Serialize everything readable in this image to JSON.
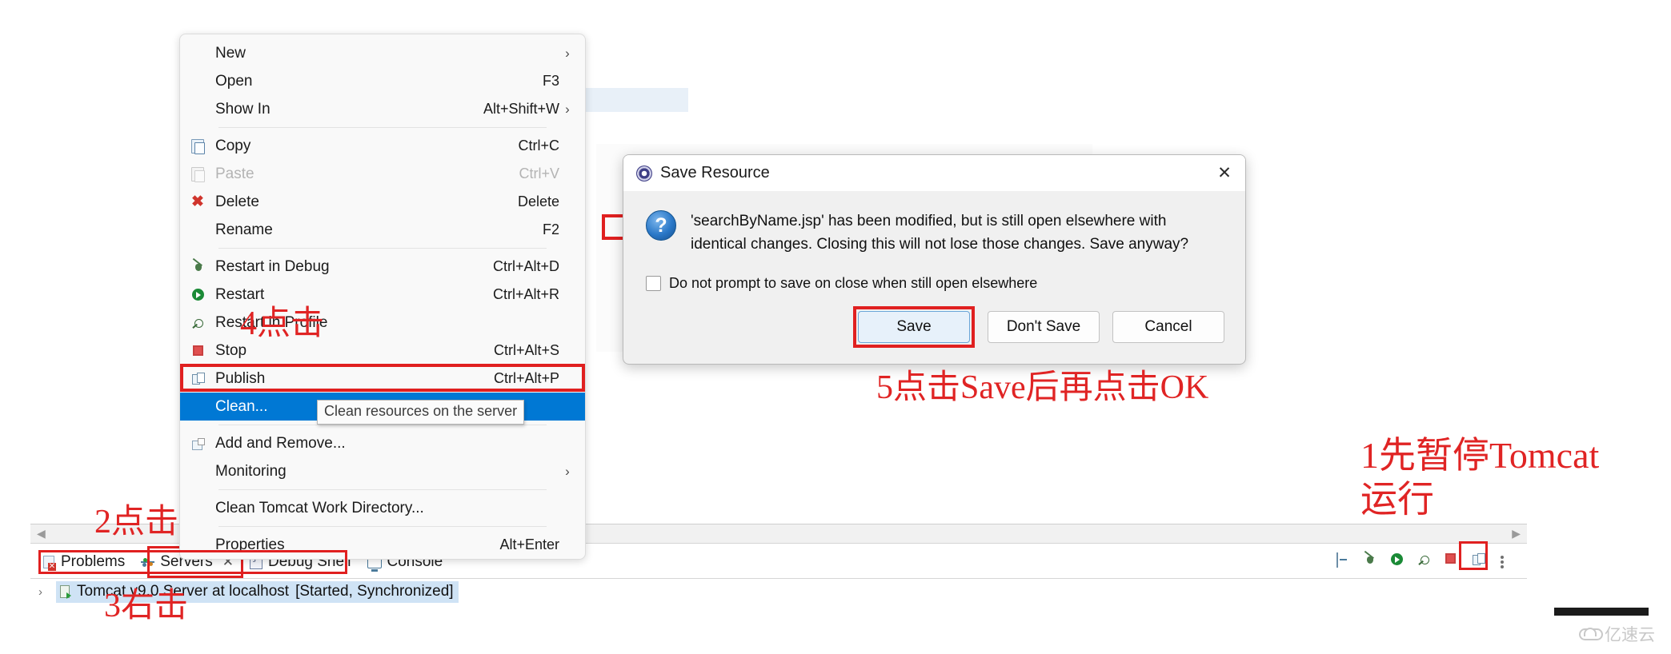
{
  "context_menu": {
    "items": [
      {
        "label": "New",
        "accel": "",
        "icon": "none",
        "submenu": true,
        "disabled": false,
        "selected": false
      },
      {
        "label": "Open",
        "accel": "F3",
        "icon": "none",
        "submenu": false,
        "disabled": false,
        "selected": false
      },
      {
        "label": "Show In",
        "accel": "Alt+Shift+W",
        "icon": "none",
        "submenu": true,
        "disabled": false,
        "selected": false
      },
      {
        "separator": true
      },
      {
        "label": "Copy",
        "accel": "Ctrl+C",
        "icon": "copy-icon",
        "submenu": false,
        "disabled": false,
        "selected": false
      },
      {
        "label": "Paste",
        "accel": "Ctrl+V",
        "icon": "paste-icon",
        "submenu": false,
        "disabled": true,
        "selected": false
      },
      {
        "label": "Delete",
        "accel": "Delete",
        "icon": "delete-icon",
        "submenu": false,
        "disabled": false,
        "selected": false
      },
      {
        "label": "Rename",
        "accel": "F2",
        "icon": "none",
        "submenu": false,
        "disabled": false,
        "selected": false
      },
      {
        "separator": true
      },
      {
        "label": "Restart in Debug",
        "accel": "Ctrl+Alt+D",
        "icon": "bug-icon",
        "submenu": false,
        "disabled": false,
        "selected": false
      },
      {
        "label": "Restart",
        "accel": "Ctrl+Alt+R",
        "icon": "play-icon",
        "submenu": false,
        "disabled": false,
        "selected": false
      },
      {
        "label": "Restart in Profile",
        "accel": "",
        "icon": "profile-icon",
        "submenu": false,
        "disabled": false,
        "selected": false
      },
      {
        "label": "Stop",
        "accel": "Ctrl+Alt+S",
        "icon": "stop-icon",
        "submenu": false,
        "disabled": false,
        "selected": false
      },
      {
        "label": "Publish",
        "accel": "Ctrl+Alt+P",
        "icon": "publish-icon",
        "submenu": false,
        "disabled": false,
        "selected": false
      },
      {
        "label": "Clean...",
        "accel": "",
        "icon": "none",
        "submenu": false,
        "disabled": false,
        "selected": true
      },
      {
        "separator": true
      },
      {
        "label": "Add and Remove...",
        "accel": "",
        "icon": "add-remove-icon",
        "submenu": false,
        "disabled": false,
        "selected": false
      },
      {
        "label": "Monitoring",
        "accel": "",
        "icon": "none",
        "submenu": true,
        "disabled": false,
        "selected": false
      },
      {
        "separator": true
      },
      {
        "label": "Clean Tomcat Work Directory...",
        "accel": "",
        "icon": "none",
        "submenu": false,
        "disabled": false,
        "selected": false
      },
      {
        "separator": true
      },
      {
        "label": "Properties",
        "accel": "Alt+Enter",
        "icon": "none",
        "submenu": false,
        "disabled": false,
        "selected": false
      }
    ],
    "tooltip": "Clean resources on the server",
    "selection_outline_color": "#e02020",
    "selection_bg_color": "#0078d4"
  },
  "dialog": {
    "title": "Save Resource",
    "close_label": "✕",
    "message": "'searchByName.jsp' has been modified, but is still open elsewhere with identical changes. Closing this will not lose those changes. Save anyway?",
    "question_glyph": "?",
    "checkbox_label": "Do not prompt to save on close when still open elsewhere",
    "checkbox_checked": false,
    "buttons": [
      {
        "label": "Save",
        "default": true
      },
      {
        "label": "Don't Save",
        "default": false
      },
      {
        "label": "Cancel",
        "default": false
      }
    ],
    "highlight_color": "#e02020"
  },
  "bottom_panel": {
    "tabs": [
      {
        "label": "Problems",
        "icon": "problems-icon",
        "active": false,
        "closable": false
      },
      {
        "label": "Servers",
        "icon": "servers-icon",
        "active": true,
        "closable": true,
        "close_glyph": "✕"
      },
      {
        "label": "Debug Shell",
        "icon": "debug-shell-icon",
        "active": false,
        "closable": false
      },
      {
        "label": "Console",
        "icon": "console-icon",
        "active": false,
        "closable": false
      }
    ],
    "server_row": {
      "expander": "›",
      "name": "Tomcat v9.0 Server at localhost",
      "status": "[Started, Synchronized]"
    },
    "scroll_left_glyph": "◀",
    "scroll_right_glyph": "▶",
    "toolbar_icons": [
      "minimize-icon",
      "debug-icon",
      "run-icon",
      "profile-icon",
      "stop-icon",
      "publish-icon",
      "view-menu-icon"
    ]
  },
  "annotations": [
    {
      "id": "annot-1",
      "text": "1先暂停Tomcat"
    },
    {
      "id": "annot-1b",
      "text": "运行"
    },
    {
      "id": "annot-2",
      "text": "2点击"
    },
    {
      "id": "annot-3",
      "text": "3右击"
    },
    {
      "id": "annot-4",
      "text": "4点击"
    },
    {
      "id": "annot-5",
      "text": "5点击Save后再点击OK"
    }
  ],
  "watermark": {
    "text": "亿速云"
  }
}
